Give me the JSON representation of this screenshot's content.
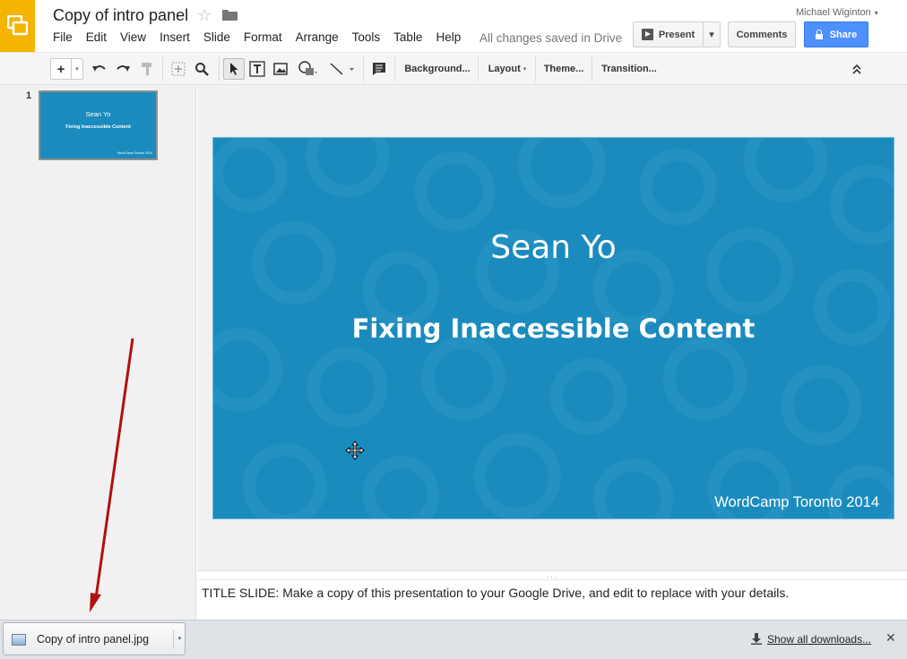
{
  "header": {
    "doc_title": "Copy of intro panel",
    "save_status": "All changes saved in Drive",
    "user_name": "Michael Wiginton",
    "present_label": "Present",
    "comments_label": "Comments",
    "share_label": "Share",
    "star_glyph": "☆",
    "caret_glyph": "▾"
  },
  "menu": [
    "File",
    "Edit",
    "View",
    "Insert",
    "Slide",
    "Format",
    "Arrange",
    "Tools",
    "Table",
    "Help"
  ],
  "toolbar": {
    "new_glyph": "+",
    "background_label": "Background...",
    "layout_label": "Layout",
    "theme_label": "Theme...",
    "transition_label": "Transition...",
    "icons": [
      "undo-icon",
      "redo-icon",
      "paint-format-icon",
      "zoom-fit-icon",
      "zoom-icon",
      "select-icon",
      "textbox-icon",
      "image-icon",
      "shape-icon",
      "line-icon",
      "comment-icon",
      "collapse-icon"
    ]
  },
  "filmstrip": {
    "slide_number": "1",
    "thumb_title": "Sean Yo",
    "thumb_subtitle": "Fixing Inaccessible Content",
    "thumb_footer": "WordCamp Toronto 2014"
  },
  "slide": {
    "title": "Sean Yo",
    "subtitle": "Fixing Inaccessible Content",
    "footer": "WordCamp Toronto 2014",
    "background_color": "#1b8bbd"
  },
  "notes": {
    "text": "TITLE SLIDE:  Make a copy of this presentation to your Google Drive, and edit to replace with your details.",
    "grip": "···"
  },
  "downloads": {
    "file_name": "Copy of intro panel.jpg",
    "show_all_label": "Show all downloads...",
    "close_glyph": "✕"
  },
  "colors": {
    "app_logo": "#f4b400",
    "share_button": "#4d90fe",
    "annotation_arrow": "#b01010"
  }
}
